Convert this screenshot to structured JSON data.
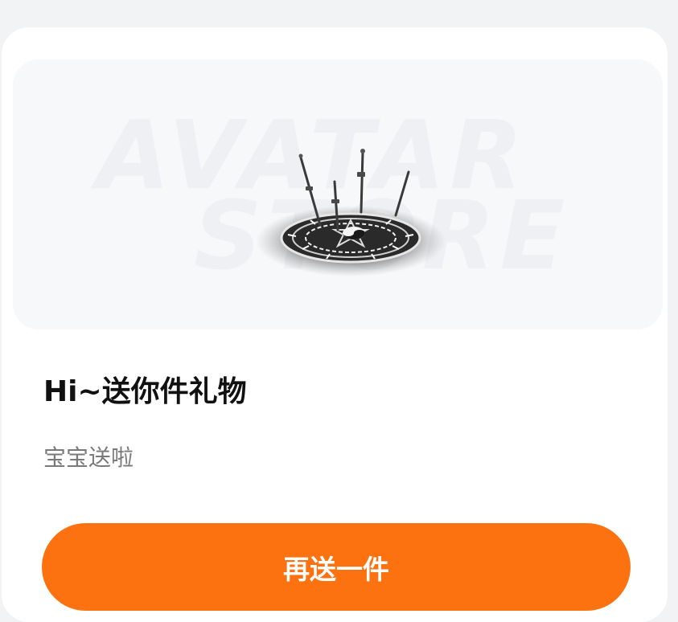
{
  "hero": {
    "watermark_line1": "AVATAR",
    "watermark_line2": "STORE",
    "image_icon": "magic-circle-with-swords"
  },
  "gift": {
    "title": "Hi~送你件礼物",
    "subtitle": "宝宝送啦"
  },
  "actions": {
    "send_again_label": "再送一件"
  },
  "colors": {
    "page_bg": "#f2f3f5",
    "card_bg": "#ffffff",
    "hero_bg": "#f7f8fa",
    "accent": "#fd7210",
    "title_text": "#111111",
    "subtitle_text": "#7a7a7a"
  }
}
